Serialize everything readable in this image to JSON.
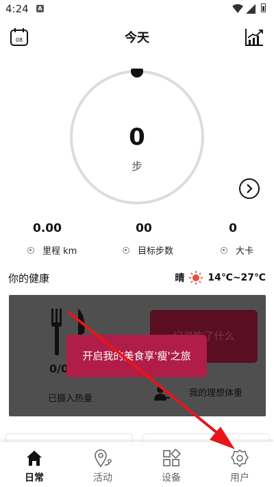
{
  "status_bar": {
    "time": "4:24",
    "app_badge": "A"
  },
  "header": {
    "title": "今天",
    "calendar_day": "08"
  },
  "ring": {
    "steps": "0",
    "steps_unit": "步"
  },
  "stats": [
    {
      "value": "0.00",
      "label": "里程 km"
    },
    {
      "value": "00",
      "label": "目标步数"
    },
    {
      "value": "0",
      "label": "大卡"
    }
  ],
  "health": {
    "title": "你的健康",
    "weather_condition": "晴",
    "temperature": "14℃~27℃"
  },
  "card": {
    "kcal_fraction": "0/0",
    "calories_taken_label": "已摄入热量",
    "what_button_label": "记录吃了什么",
    "ideal_weight_label": "我的理想体重",
    "toast_text": "开启我的美食享'瘦'之旅"
  },
  "nav": {
    "items": [
      {
        "label": "日常",
        "icon": "home-icon",
        "active": true
      },
      {
        "label": "活动",
        "icon": "location-pin-icon",
        "active": false
      },
      {
        "label": "设备",
        "icon": "grid-icon",
        "active": false
      },
      {
        "label": "用户",
        "icon": "gear-icon",
        "active": false
      }
    ]
  },
  "colors": {
    "accent_toast": "#b01d48",
    "card_bg": "#4f4f4f",
    "annotation_arrow": "#e8141a"
  }
}
